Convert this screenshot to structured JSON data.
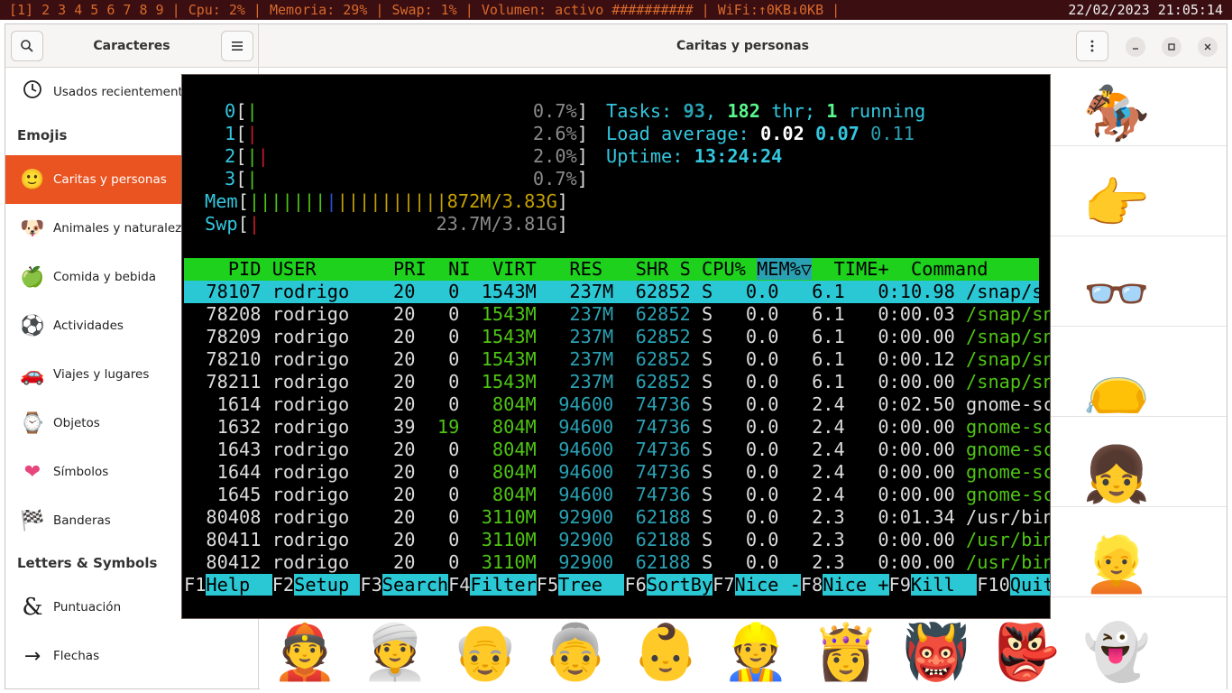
{
  "topbar": {
    "workspaces": "[1] 2 3 4 5 6 7 8 9",
    "cpu": "Cpu: 2%",
    "mem": "Memoria: 29%",
    "swap": "Swap: 1%",
    "volume": "Volumen: activo ##########",
    "wifi": "WiFi:↑0KB↓0KB",
    "clock": "22/02/2023 21:05:14"
  },
  "headerbar": {
    "left_title": "Caracteres",
    "main_title": "Caritas y personas"
  },
  "sidebar": {
    "recent": "Usados recientemente",
    "section_emojis": "Emojis",
    "items": [
      {
        "label": "Caritas y personas",
        "icon": "🙂"
      },
      {
        "label": "Animales y naturaleza",
        "icon": "🐶"
      },
      {
        "label": "Comida y bebida",
        "icon": "🍏"
      },
      {
        "label": "Actividades",
        "icon": "⚽"
      },
      {
        "label": "Viajes y lugares",
        "icon": "🚗"
      },
      {
        "label": "Objetos",
        "icon": "⌚"
      },
      {
        "label": "Símbolos",
        "icon": "❤"
      },
      {
        "label": "Banderas",
        "icon": "🏁"
      }
    ],
    "section_letters": "Letters & Symbols",
    "letters_items": [
      {
        "label": "Puntuación",
        "icon": "&"
      },
      {
        "label": "Flechas",
        "icon": "→"
      }
    ]
  },
  "emojis_right": [
    "🏇",
    "👉",
    "👓",
    "👝",
    "👧",
    "👱"
  ],
  "emojis_bottom": [
    "👲",
    "👳",
    "👴",
    "👵",
    "👶",
    "👷",
    "👸",
    "👹",
    "👺",
    "👻"
  ],
  "htop": {
    "cpus": [
      {
        "id": "0",
        "pct": "0.7%"
      },
      {
        "id": "1",
        "pct": "2.6%"
      },
      {
        "id": "2",
        "pct": "2.0%"
      },
      {
        "id": "3",
        "pct": "0.7%"
      }
    ],
    "mem_label": "Mem",
    "mem_value": "872M/3.83G",
    "swp_label": "Swp",
    "swp_value": "23.7M/3.81G",
    "tasks_label": "Tasks:",
    "tasks": "93",
    "threads": "182",
    "thr_label": "thr;",
    "running": "1",
    "running_label": "running",
    "load_label": "Load average:",
    "load1": "0.02",
    "load5": "0.07",
    "load15": "0.11",
    "uptime_label": "Uptime:",
    "uptime": "13:24:24",
    "columns": [
      "PID",
      "USER",
      "PRI",
      "NI",
      "VIRT",
      "RES",
      "SHR",
      "S",
      "CPU%",
      "MEM%▽",
      "TIME+",
      "Command"
    ],
    "processes": [
      {
        "pid": "78107",
        "user": "rodrigo",
        "pri": "20",
        "ni": "0",
        "virt": "1543M",
        "res": "237M",
        "shr": "62852",
        "s": "S",
        "cpu": "0.0",
        "mem": "6.1",
        "time": "0:10.98",
        "cmd": "/snap/snap-sto",
        "thread": false
      },
      {
        "pid": "78208",
        "user": "rodrigo",
        "pri": "20",
        "ni": "0",
        "virt": "1543M",
        "res": "237M",
        "shr": "62852",
        "s": "S",
        "cpu": "0.0",
        "mem": "6.1",
        "time": "0:00.03",
        "cmd": "/snap/snap-sto",
        "thread": true
      },
      {
        "pid": "78209",
        "user": "rodrigo",
        "pri": "20",
        "ni": "0",
        "virt": "1543M",
        "res": "237M",
        "shr": "62852",
        "s": "S",
        "cpu": "0.0",
        "mem": "6.1",
        "time": "0:00.00",
        "cmd": "/snap/snap-sto",
        "thread": true
      },
      {
        "pid": "78210",
        "user": "rodrigo",
        "pri": "20",
        "ni": "0",
        "virt": "1543M",
        "res": "237M",
        "shr": "62852",
        "s": "S",
        "cpu": "0.0",
        "mem": "6.1",
        "time": "0:00.12",
        "cmd": "/snap/snap-sto",
        "thread": true
      },
      {
        "pid": "78211",
        "user": "rodrigo",
        "pri": "20",
        "ni": "0",
        "virt": "1543M",
        "res": "237M",
        "shr": "62852",
        "s": "S",
        "cpu": "0.0",
        "mem": "6.1",
        "time": "0:00.00",
        "cmd": "/snap/snap-sto",
        "thread": true
      },
      {
        "pid": "1614",
        "user": "rodrigo",
        "pri": "20",
        "ni": "0",
        "virt": "804M",
        "res": "94600",
        "shr": "74736",
        "s": "S",
        "cpu": "0.0",
        "mem": "2.4",
        "time": "0:02.50",
        "cmd": "gnome-screensa",
        "thread": false
      },
      {
        "pid": "1632",
        "user": "rodrigo",
        "pri": "39",
        "ni": "19",
        "virt": "804M",
        "res": "94600",
        "shr": "74736",
        "s": "S",
        "cpu": "0.0",
        "mem": "2.4",
        "time": "0:00.00",
        "cmd": "gnome-screensa",
        "thread": true
      },
      {
        "pid": "1643",
        "user": "rodrigo",
        "pri": "20",
        "ni": "0",
        "virt": "804M",
        "res": "94600",
        "shr": "74736",
        "s": "S",
        "cpu": "0.0",
        "mem": "2.4",
        "time": "0:00.00",
        "cmd": "gnome-screensa",
        "thread": true
      },
      {
        "pid": "1644",
        "user": "rodrigo",
        "pri": "20",
        "ni": "0",
        "virt": "804M",
        "res": "94600",
        "shr": "74736",
        "s": "S",
        "cpu": "0.0",
        "mem": "2.4",
        "time": "0:00.00",
        "cmd": "gnome-screensa",
        "thread": true
      },
      {
        "pid": "1645",
        "user": "rodrigo",
        "pri": "20",
        "ni": "0",
        "virt": "804M",
        "res": "94600",
        "shr": "74736",
        "s": "S",
        "cpu": "0.0",
        "mem": "2.4",
        "time": "0:00.00",
        "cmd": "gnome-screensa",
        "thread": true
      },
      {
        "pid": "80408",
        "user": "rodrigo",
        "pri": "20",
        "ni": "0",
        "virt": "3110M",
        "res": "92900",
        "shr": "62188",
        "s": "S",
        "cpu": "0.0",
        "mem": "2.3",
        "time": "0:01.34",
        "cmd": "/usr/bin/gjs /",
        "thread": false
      },
      {
        "pid": "80411",
        "user": "rodrigo",
        "pri": "20",
        "ni": "0",
        "virt": "3110M",
        "res": "92900",
        "shr": "62188",
        "s": "S",
        "cpu": "0.0",
        "mem": "2.3",
        "time": "0:00.00",
        "cmd": "/usr/bin/gjs /",
        "thread": true
      },
      {
        "pid": "80412",
        "user": "rodrigo",
        "pri": "20",
        "ni": "0",
        "virt": "3110M",
        "res": "92900",
        "shr": "62188",
        "s": "S",
        "cpu": "0.0",
        "mem": "2.3",
        "time": "0:00.00",
        "cmd": "/usr/bin/gjs /",
        "thread": true
      }
    ],
    "fkeys": [
      {
        "key": "F1",
        "label": "Help  "
      },
      {
        "key": "F2",
        "label": "Setup "
      },
      {
        "key": "F3",
        "label": "Search"
      },
      {
        "key": "F4",
        "label": "Filter"
      },
      {
        "key": "F5",
        "label": "Tree  "
      },
      {
        "key": "F6",
        "label": "SortBy"
      },
      {
        "key": "F7",
        "label": "Nice -"
      },
      {
        "key": "F8",
        "label": "Nice +"
      },
      {
        "key": "F9",
        "label": "Kill  "
      },
      {
        "key": "F10",
        "label": "Quit"
      }
    ]
  }
}
